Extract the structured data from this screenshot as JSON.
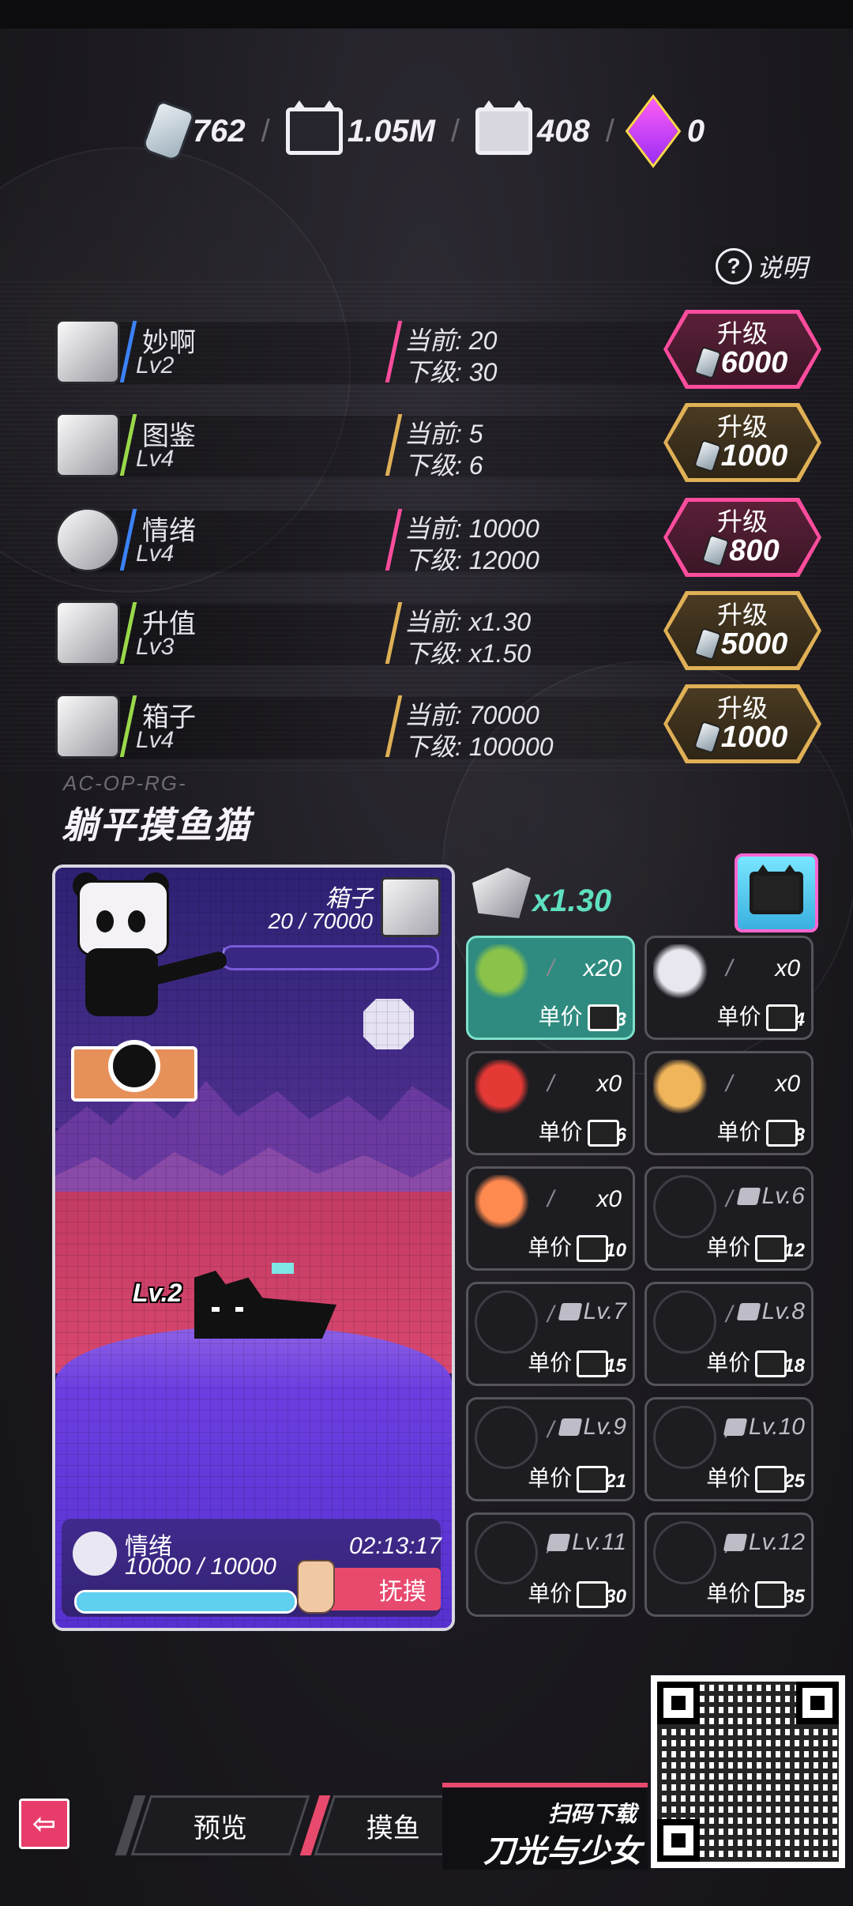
{
  "currency": [
    {
      "icon": "milk-bottle-icon",
      "value": "762"
    },
    {
      "icon": "cat-box-icon",
      "value": "1.05M"
    },
    {
      "icon": "cat-box-light-icon",
      "value": "408"
    },
    {
      "icon": "purple-cube-icon",
      "value": "0"
    }
  ],
  "help_label": "说明",
  "upgrades": [
    {
      "name": "妙啊",
      "level": "Lv2",
      "current": "当前: 20",
      "next": "下级: 30",
      "button_label": "升级",
      "cost": "6000",
      "style": "pink",
      "icon": "bulb-icon"
    },
    {
      "name": "图鉴",
      "level": "Lv4",
      "current": "当前: 5",
      "next": "下级: 6",
      "button_label": "升级",
      "cost": "1000",
      "style": "gold",
      "icon": "book-icon"
    },
    {
      "name": "情绪",
      "level": "Lv4",
      "current": "当前: 10000",
      "next": "下级: 12000",
      "button_label": "升级",
      "cost": "800",
      "style": "pink",
      "icon": "smiley-icon"
    },
    {
      "name": "升值",
      "level": "Lv3",
      "current": "当前: x1.30",
      "next": "下级: x1.50",
      "button_label": "升级",
      "cost": "5000",
      "style": "gold",
      "icon": "chart-up-icon"
    },
    {
      "name": "箱子",
      "level": "Lv4",
      "current": "当前: 70000",
      "next": "下级: 100000",
      "button_label": "升级",
      "cost": "1000",
      "style": "gold",
      "icon": "box-icon"
    }
  ],
  "game": {
    "subcode": "AC-OP-RG-",
    "title": "躺平摸鱼猫",
    "box_label": "箱子",
    "box_count": "20 / 70000",
    "box_fill": 0.0003,
    "cat_level": "Lv.2",
    "mood_label": "情绪",
    "mood_value": "10000 / 10000",
    "mood_fill": 1.0,
    "timer": "02:13:17",
    "stroke_label": "抚摸"
  },
  "multiplier": "x1.30",
  "items": [
    {
      "icon": "apple-core-icon",
      "count": "x20",
      "price_label": "单价",
      "price": "3",
      "active": true,
      "locked": false
    },
    {
      "icon": "fish-bone-icon",
      "count": "x0",
      "price_label": "单价",
      "price": "4",
      "active": false,
      "locked": false
    },
    {
      "icon": "soda-can-icon",
      "count": "x0",
      "price_label": "单价",
      "price": "6",
      "active": false,
      "locked": false
    },
    {
      "icon": "dried-fish-icon",
      "count": "x0",
      "price_label": "单价",
      "price": "8",
      "active": false,
      "locked": false
    },
    {
      "icon": "shrimp-icon",
      "count": "x0",
      "price_label": "单价",
      "price": "10",
      "active": false,
      "locked": false
    },
    {
      "icon": "locked-item-icon",
      "level": "Lv.6",
      "price_label": "单价",
      "price": "12",
      "active": false,
      "locked": true
    },
    {
      "icon": "locked-item-icon",
      "level": "Lv.7",
      "price_label": "单价",
      "price": "15",
      "active": false,
      "locked": true
    },
    {
      "icon": "locked-item-icon",
      "level": "Lv.8",
      "price_label": "单价",
      "price": "18",
      "active": false,
      "locked": true
    },
    {
      "icon": "locked-item-icon",
      "level": "Lv.9",
      "price_label": "单价",
      "price": "21",
      "active": false,
      "locked": true
    },
    {
      "icon": "locked-item-icon",
      "level": "Lv.10",
      "price_label": "单价",
      "price": "25",
      "active": false,
      "locked": true
    },
    {
      "icon": "locked-item-icon",
      "level": "Lv.11",
      "price_label": "单价",
      "price": "30",
      "active": false,
      "locked": true
    },
    {
      "icon": "locked-item-icon",
      "level": "Lv.12",
      "price_label": "单价",
      "price": "35",
      "active": false,
      "locked": true
    }
  ],
  "nav": {
    "back_icon": "back-arrow-icon",
    "preview_tab": "预览",
    "fishing_tab": "摸鱼"
  },
  "ad": {
    "scan_text": "扫码下载",
    "game_name": "刀光与少女"
  },
  "colors": {
    "pink": "#ff4d9d",
    "gold": "#e0b056",
    "teal": "#2f8b7f",
    "accent_cyan": "#5fe0c0"
  }
}
